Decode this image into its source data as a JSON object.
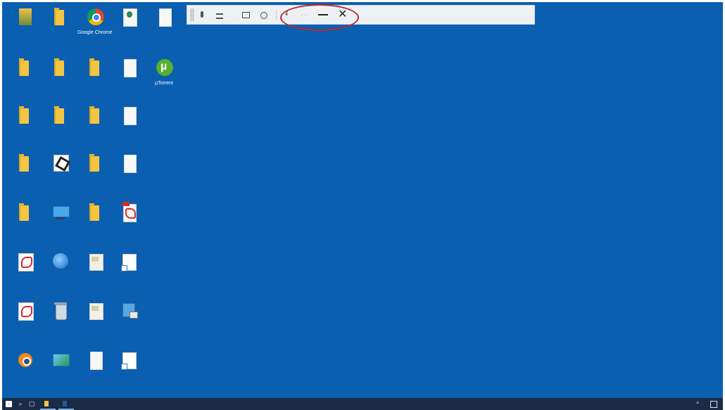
{
  "desktop": {
    "icons": [
      {
        "id": "admin-tool",
        "label": "",
        "type": "admin",
        "col": 0,
        "row": 0
      },
      {
        "id": "folder-1",
        "label": "",
        "type": "folder",
        "col": 1,
        "row": 0
      },
      {
        "id": "chrome",
        "label": "Google Chrome",
        "type": "chrome",
        "col": 2,
        "row": 0
      },
      {
        "id": "mt-app",
        "label": "",
        "type": "mt",
        "col": 3,
        "row": 0
      },
      {
        "id": "doc-1",
        "label": "",
        "type": "doc",
        "col": 4,
        "row": 0
      },
      {
        "id": "folder-2",
        "label": "",
        "type": "folder",
        "col": 0,
        "row": 1
      },
      {
        "id": "folder-3",
        "label": "",
        "type": "folder",
        "col": 1,
        "row": 1
      },
      {
        "id": "folder-4",
        "label": "",
        "type": "folder",
        "col": 2,
        "row": 1
      },
      {
        "id": "doc-2",
        "label": "",
        "type": "doc",
        "col": 3,
        "row": 1
      },
      {
        "id": "utorrent",
        "label": "µTorrent",
        "type": "utorrent",
        "col": 4,
        "row": 1
      },
      {
        "id": "folder-5",
        "label": "",
        "type": "folder",
        "col": 0,
        "row": 2
      },
      {
        "id": "folder-6",
        "label": "",
        "type": "folder",
        "col": 1,
        "row": 2
      },
      {
        "id": "folder-7",
        "label": "",
        "type": "folder",
        "col": 2,
        "row": 2
      },
      {
        "id": "doc-3",
        "label": "",
        "type": "doc",
        "col": 3,
        "row": 2
      },
      {
        "id": "folder-8",
        "label": "",
        "type": "folder",
        "col": 0,
        "row": 3
      },
      {
        "id": "unity",
        "label": "",
        "type": "unity",
        "col": 1,
        "row": 3
      },
      {
        "id": "folder-9",
        "label": "",
        "type": "folder",
        "col": 2,
        "row": 3
      },
      {
        "id": "doc-4",
        "label": "",
        "type": "doc",
        "col": 3,
        "row": 3
      },
      {
        "id": "folder-10",
        "label": "",
        "type": "folder",
        "col": 0,
        "row": 4
      },
      {
        "id": "this-pc",
        "label": "",
        "type": "computer",
        "col": 1,
        "row": 4
      },
      {
        "id": "folder-11",
        "label": "",
        "type": "folder",
        "col": 2,
        "row": 4
      },
      {
        "id": "pdf-1",
        "label": "",
        "type": "pdf",
        "col": 3,
        "row": 4
      },
      {
        "id": "acrobat-reader",
        "label": "",
        "type": "acrobat",
        "col": 0,
        "row": 5
      },
      {
        "id": "network",
        "label": "",
        "type": "globe",
        "col": 1,
        "row": 5
      },
      {
        "id": "img-1",
        "label": "",
        "type": "img",
        "col": 2,
        "row": 5
      },
      {
        "id": "doc-5",
        "label": "",
        "type": "snip",
        "col": 3,
        "row": 5
      },
      {
        "id": "acrobat-pro",
        "label": "",
        "type": "acrobat",
        "col": 0,
        "row": 6
      },
      {
        "id": "recycle-bin",
        "label": "",
        "type": "bin",
        "col": 1,
        "row": 6
      },
      {
        "id": "img-2",
        "label": "",
        "type": "img",
        "col": 2,
        "row": 6
      },
      {
        "id": "device-manager",
        "label": "",
        "type": "devmgr",
        "col": 3,
        "row": 6
      },
      {
        "id": "blender",
        "label": "",
        "type": "blender",
        "col": 0,
        "row": 7
      },
      {
        "id": "control-panel",
        "label": "",
        "type": "panel",
        "col": 1,
        "row": 7
      },
      {
        "id": "doc-6",
        "label": "",
        "type": "doc",
        "col": 2,
        "row": 7
      },
      {
        "id": "shortcut-1",
        "label": "",
        "type": "snip",
        "col": 3,
        "row": 7
      }
    ]
  },
  "toolbar": {
    "pin_icon": "pin-icon",
    "signal_icon": "signal-icon",
    "title": "",
    "switch_label": "",
    "usb_label": "",
    "control_label": "",
    "more": "···",
    "close": "✕"
  },
  "taskbar": {
    "search_icon": "⌕",
    "taskview_icon": "▢",
    "app1_label": "",
    "app2_label": "",
    "tray_caret": "^",
    "tray_text": ""
  }
}
